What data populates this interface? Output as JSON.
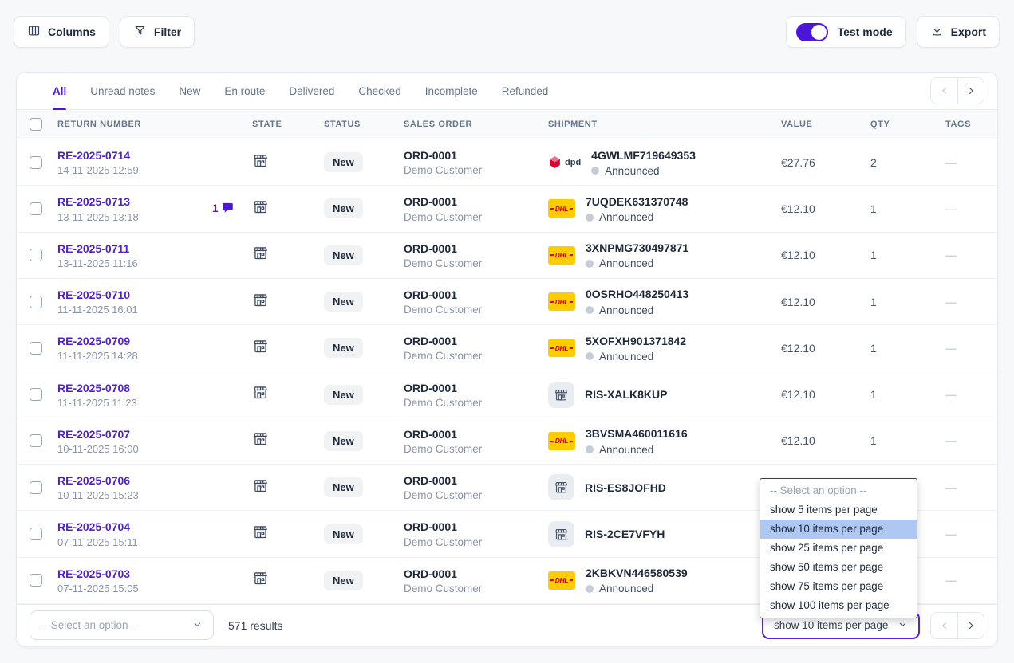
{
  "toolbar": {
    "columns_label": "Columns",
    "filter_label": "Filter",
    "test_mode_label": "Test mode",
    "test_mode_on": true,
    "export_label": "Export"
  },
  "tabs": [
    {
      "label": "All",
      "active": true
    },
    {
      "label": "Unread notes",
      "active": false
    },
    {
      "label": "New",
      "active": false
    },
    {
      "label": "En route",
      "active": false
    },
    {
      "label": "Delivered",
      "active": false
    },
    {
      "label": "Checked",
      "active": false
    },
    {
      "label": "Incomplete",
      "active": false
    },
    {
      "label": "Refunded",
      "active": false
    }
  ],
  "carriers": {
    "dpd_label": "dpd",
    "dhl_label": "DHL"
  },
  "table": {
    "headers": [
      "RETURN NUMBER",
      "STATE",
      "STATUS",
      "SALES ORDER",
      "SHIPMENT",
      "VALUE",
      "QTY",
      "TAGS"
    ],
    "rows": [
      {
        "return_number": "RE-2025-0714",
        "date": "14-11-2025 12:59",
        "notes": "",
        "status": "New",
        "sales_order": "ORD-0001",
        "customer": "Demo Customer",
        "carrier": "dpd",
        "tracking": "4GWLMF719649353",
        "shipment_status": "Announced",
        "value": "€27.76",
        "qty": "2",
        "tags": "—"
      },
      {
        "return_number": "RE-2025-0713",
        "date": "13-11-2025 13:18",
        "notes": "1",
        "status": "New",
        "sales_order": "ORD-0001",
        "customer": "Demo Customer",
        "carrier": "dhl",
        "tracking": "7UQDEK631370748",
        "shipment_status": "Announced",
        "value": "€12.10",
        "qty": "1",
        "tags": "—"
      },
      {
        "return_number": "RE-2025-0711",
        "date": "13-11-2025 11:16",
        "notes": "",
        "status": "New",
        "sales_order": "ORD-0001",
        "customer": "Demo Customer",
        "carrier": "dhl",
        "tracking": "3XNPMG730497871",
        "shipment_status": "Announced",
        "value": "€12.10",
        "qty": "1",
        "tags": "—"
      },
      {
        "return_number": "RE-2025-0710",
        "date": "11-11-2025 16:01",
        "notes": "",
        "status": "New",
        "sales_order": "ORD-0001",
        "customer": "Demo Customer",
        "carrier": "dhl",
        "tracking": "0OSRHO448250413",
        "shipment_status": "Announced",
        "value": "€12.10",
        "qty": "1",
        "tags": "—"
      },
      {
        "return_number": "RE-2025-0709",
        "date": "11-11-2025 14:28",
        "notes": "",
        "status": "New",
        "sales_order": "ORD-0001",
        "customer": "Demo Customer",
        "carrier": "dhl",
        "tracking": "5XOFXH901371842",
        "shipment_status": "Announced",
        "value": "€12.10",
        "qty": "1",
        "tags": "—"
      },
      {
        "return_number": "RE-2025-0708",
        "date": "11-11-2025 11:23",
        "notes": "",
        "status": "New",
        "sales_order": "ORD-0001",
        "customer": "Demo Customer",
        "carrier": "store",
        "tracking": "RIS-XALK8KUP",
        "shipment_status": "",
        "value": "€12.10",
        "qty": "1",
        "tags": "—"
      },
      {
        "return_number": "RE-2025-0707",
        "date": "10-11-2025 16:00",
        "notes": "",
        "status": "New",
        "sales_order": "ORD-0001",
        "customer": "Demo Customer",
        "carrier": "dhl",
        "tracking": "3BVSMA460011616",
        "shipment_status": "Announced",
        "value": "€12.10",
        "qty": "1",
        "tags": "—"
      },
      {
        "return_number": "RE-2025-0706",
        "date": "10-11-2025 15:23",
        "notes": "",
        "status": "New",
        "sales_order": "ORD-0001",
        "customer": "Demo Customer",
        "carrier": "store",
        "tracking": "RIS-ES8JOFHD",
        "shipment_status": "",
        "value": "",
        "qty": "",
        "tags": "—"
      },
      {
        "return_number": "RE-2025-0704",
        "date": "07-11-2025 15:11",
        "notes": "",
        "status": "New",
        "sales_order": "ORD-0001",
        "customer": "Demo Customer",
        "carrier": "store",
        "tracking": "RIS-2CE7VFYH",
        "shipment_status": "",
        "value": "",
        "qty": "",
        "tags": "—"
      },
      {
        "return_number": "RE-2025-0703",
        "date": "07-11-2025 15:05",
        "notes": "",
        "status": "New",
        "sales_order": "ORD-0001",
        "customer": "Demo Customer",
        "carrier": "dhl",
        "tracking": "2KBKVN446580539",
        "shipment_status": "Announced",
        "value": "",
        "qty": "",
        "tags": "—"
      }
    ]
  },
  "footer": {
    "filter_placeholder": "-- Select an option --",
    "results": "571 results",
    "per_page_value": "show 10 items per page"
  },
  "per_page_dropdown": {
    "options": [
      {
        "label": "-- Select an option --",
        "muted": true,
        "selected": false
      },
      {
        "label": "show 5 items per page",
        "muted": false,
        "selected": false
      },
      {
        "label": "show 10 items per page",
        "muted": false,
        "selected": true
      },
      {
        "label": "show 25 items per page",
        "muted": false,
        "selected": false
      },
      {
        "label": "show 50 items per page",
        "muted": false,
        "selected": false
      },
      {
        "label": "show 75 items per page",
        "muted": false,
        "selected": false
      },
      {
        "label": "show 100 items per page",
        "muted": false,
        "selected": false
      }
    ]
  },
  "colors": {
    "accent_purple": "#4b16d8",
    "link_purple": "#4f1fd1",
    "dhl_yellow": "#ffcc00",
    "dhl_red": "#d40511",
    "dpd_red": "#dc0032",
    "dropdown_highlight": "#aec8f3"
  }
}
